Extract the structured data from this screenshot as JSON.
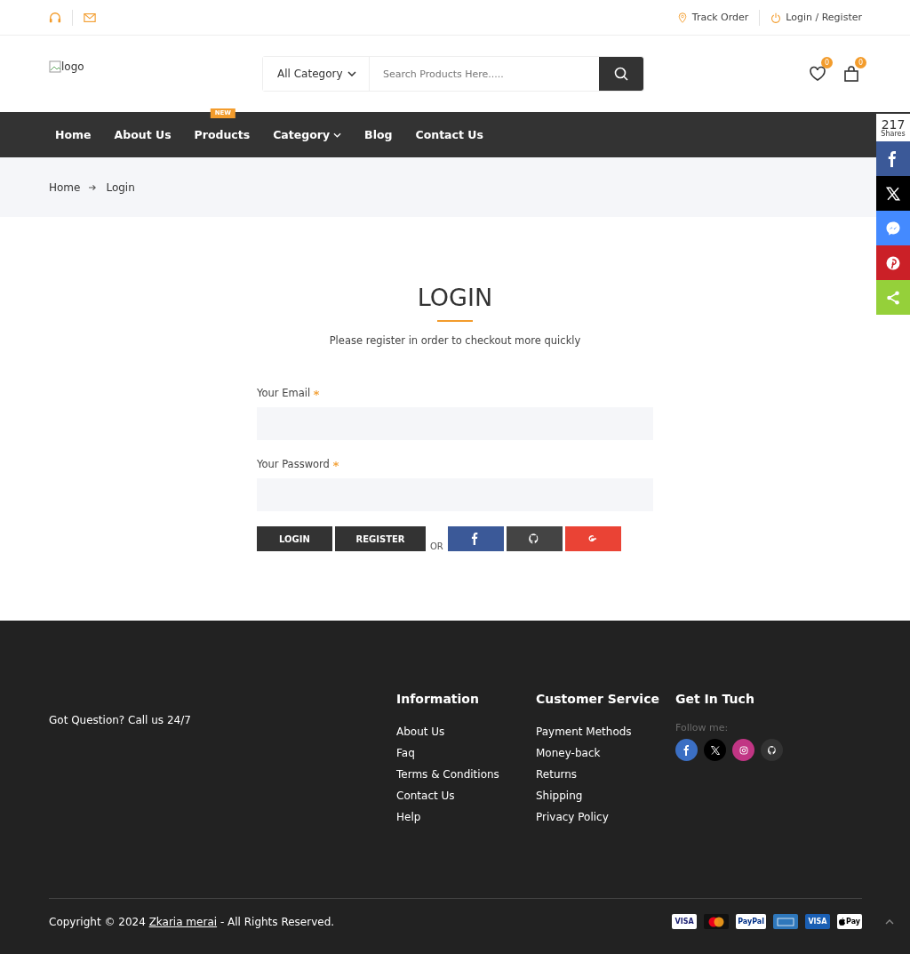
{
  "topbar": {
    "links": [
      {
        "kind": "pin",
        "label": "Track Order"
      },
      {
        "kind": "power",
        "label": "Login / Register"
      }
    ]
  },
  "header": {
    "logo_alt": "logo",
    "category": "All Category",
    "search": {
      "placeholder": "Search Products Here....."
    },
    "wishlist_count": "0",
    "cart_count": "0"
  },
  "nav": [
    {
      "label": "Home",
      "dropdown": false
    },
    {
      "label": "About Us",
      "dropdown": false
    },
    {
      "label": "Products",
      "badge": "NEW",
      "dropdown": false
    },
    {
      "label": "Category",
      "dropdown": true
    },
    {
      "label": "Blog",
      "dropdown": false
    },
    {
      "label": "Contact Us",
      "dropdown": false
    }
  ],
  "share": {
    "count": "217",
    "label": "Shares",
    "buttons": [
      {
        "kind": "facebook",
        "color": "#3b5998"
      },
      {
        "kind": "x",
        "color": "#000000"
      },
      {
        "kind": "messenger",
        "color": "#448aff"
      },
      {
        "kind": "pinterest",
        "color": "#cb2027"
      },
      {
        "kind": "share",
        "color": "#95d03a"
      }
    ]
  },
  "breadcrumb": [
    "Home",
    "Login"
  ],
  "login": {
    "title": "LOGIN",
    "subtitle": "Please register in order to checkout more quickly",
    "fields": [
      {
        "label": "Your Email",
        "required": true
      },
      {
        "label": "Your Password",
        "required": true
      }
    ],
    "login_button": "LOGIN",
    "register_button": "REGISTER",
    "or": "OR",
    "social": [
      {
        "kind": "facebook",
        "color": "#3b5998"
      },
      {
        "kind": "github",
        "color": "#444444"
      },
      {
        "kind": "google",
        "color": "#ea4335"
      }
    ]
  },
  "footer": {
    "contact": "Got Question? Call us 24/7",
    "columns": [
      {
        "title": "Information",
        "links": [
          "About Us",
          "Faq",
          "Terms & Conditions",
          "Contact Us",
          "Help"
        ]
      },
      {
        "title": "Customer Service",
        "links": [
          "Payment Methods",
          "Money-back",
          "Returns",
          "Shipping",
          "Privacy Policy"
        ]
      }
    ],
    "get_in_touch": {
      "title": "Get In Tuch",
      "follow": "Follow me:",
      "social": [
        {
          "kind": "facebook",
          "color": "#3b6fc4"
        },
        {
          "kind": "x",
          "color": "#000000"
        },
        {
          "kind": "instagram",
          "color": "#c13584"
        },
        {
          "kind": "github",
          "color": "#333333"
        }
      ]
    },
    "copyright_before": "Copyright © 2024 ",
    "copyright_link": "Zkaria merai",
    "copyright_after": " - All Rights Reserved.",
    "payments": [
      {
        "kind": "visa",
        "label": "VISA"
      },
      {
        "kind": "mastercard"
      },
      {
        "kind": "paypal",
        "label": "PayPal"
      },
      {
        "kind": "amex"
      },
      {
        "kind": "visa-blue",
        "label": "VISA"
      },
      {
        "kind": "applepay",
        "label": "Pay"
      }
    ]
  }
}
